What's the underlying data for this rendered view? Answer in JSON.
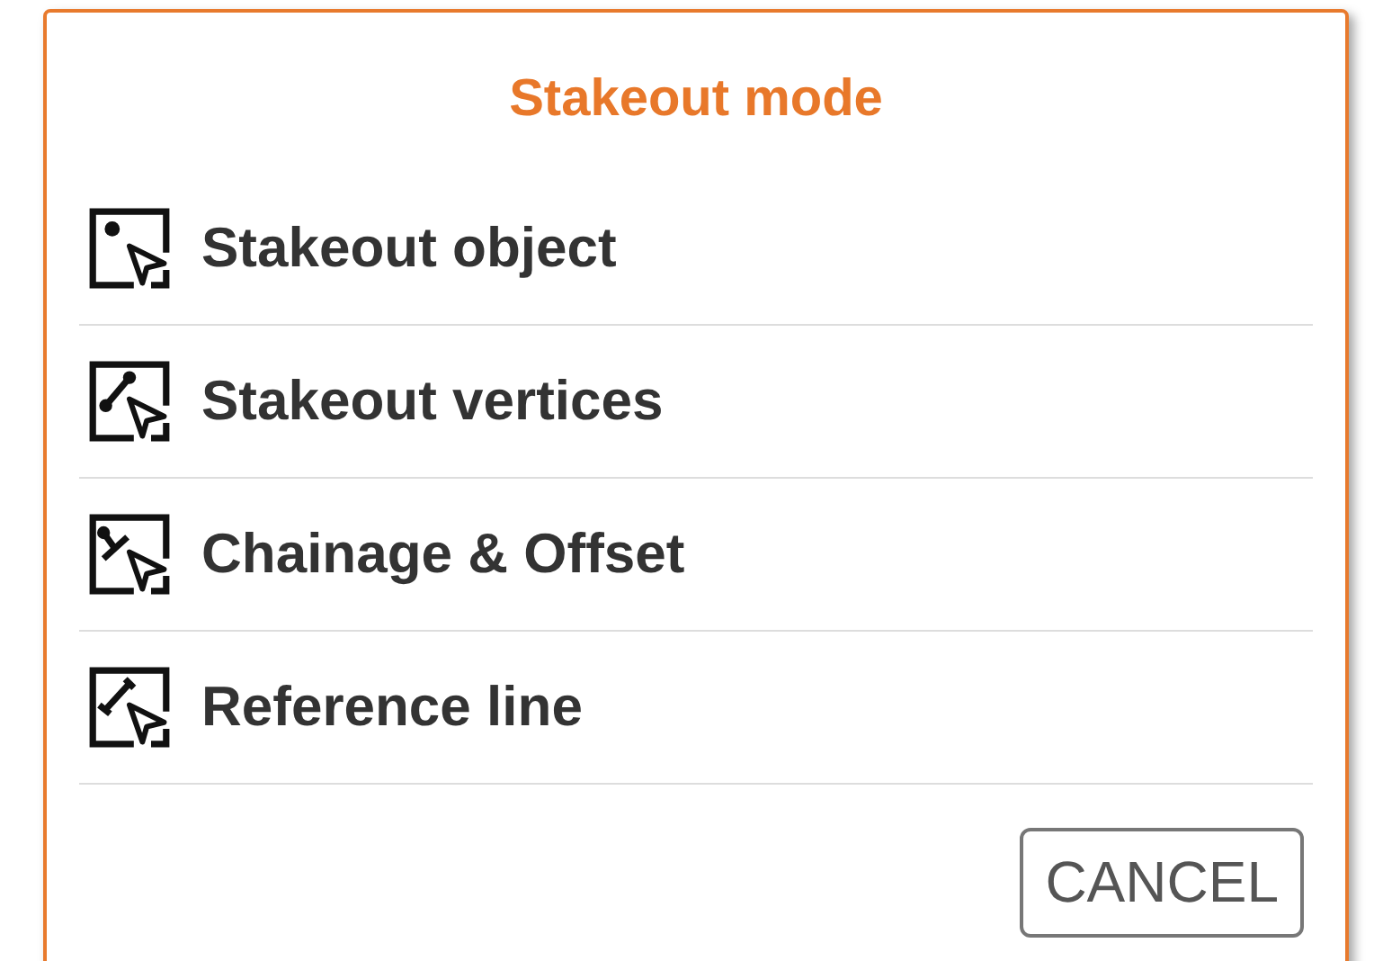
{
  "dialog": {
    "title": "Stakeout mode",
    "options": [
      {
        "kind": "point",
        "label": "Stakeout object"
      },
      {
        "kind": "vertices",
        "label": "Stakeout vertices"
      },
      {
        "kind": "chainage",
        "label": "Chainage & Offset"
      },
      {
        "kind": "reference",
        "label": "Reference line"
      }
    ],
    "buttons": [
      "CANCEL"
    ]
  }
}
